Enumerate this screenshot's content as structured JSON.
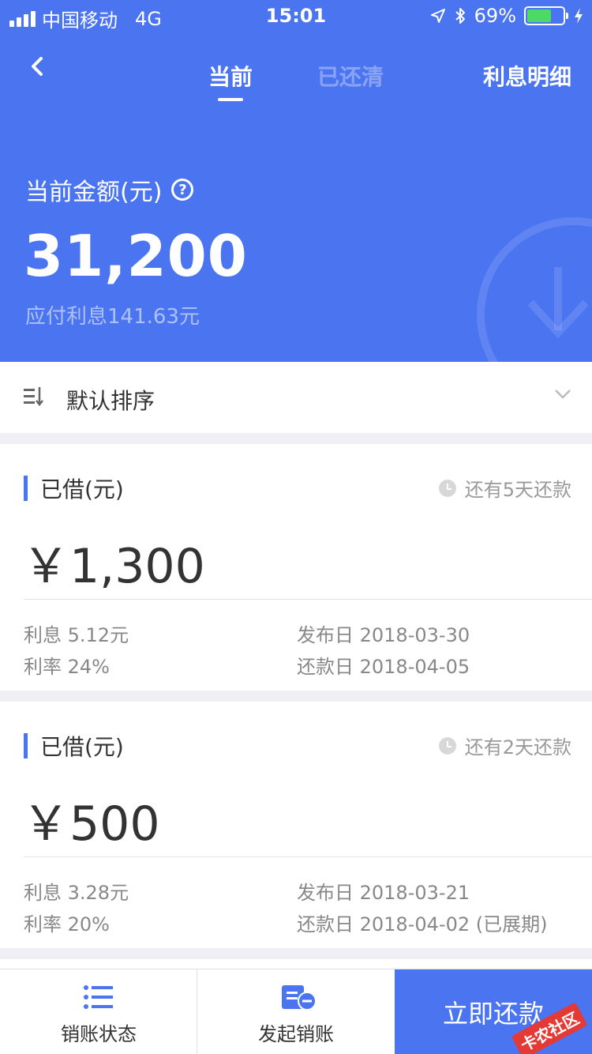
{
  "status_bar": {
    "carrier": "中国移动",
    "network": "4G",
    "time": "15:01",
    "battery": "69%",
    "battery_level": 0.69
  },
  "nav": {
    "tabs": [
      {
        "label": "当前"
      },
      {
        "label": "已还清"
      }
    ],
    "right_link": "利息明细"
  },
  "summary": {
    "label": "当前金额(元)",
    "help_symbol": "?",
    "amount": "31,200",
    "interest_due": "应付利息141.63元"
  },
  "sort": {
    "label": "默认排序"
  },
  "loans": [
    {
      "title": "已借(元)",
      "due": "还有5天还款",
      "amount": "￥1,300",
      "interest": "利息 5.12元",
      "rate": "利率 24%",
      "issue_date": "发布日 2018-03-30",
      "repay_date": "还款日 2018-04-05"
    },
    {
      "title": "已借(元)",
      "due": "还有2天还款",
      "amount": "￥500",
      "interest": "利息 3.28元",
      "rate": "利率 20%",
      "issue_date": "发布日 2018-03-21",
      "repay_date": "还款日 2018-04-02 (已展期)"
    }
  ],
  "bottom_bar": {
    "status_label": "销账状态",
    "initiate_label": "发起销账",
    "pay_label": "立即还款",
    "watermark": "卡农社区"
  },
  "colors": {
    "brand_blue": "#4a74f0",
    "battery_green": "#4cd964"
  }
}
